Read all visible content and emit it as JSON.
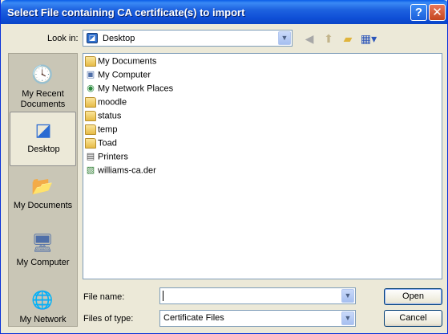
{
  "window": {
    "title": "Select File containing CA certificate(s) to import",
    "help_button": "?",
    "close_button": "✕"
  },
  "look_in": {
    "label": "Look in:",
    "value": "Desktop"
  },
  "toolbar": {
    "back_icon": "back-icon",
    "up_icon": "up-one-level-icon",
    "new_folder_icon": "new-folder-icon",
    "views_icon": "views-menu-icon"
  },
  "places": [
    {
      "label": "My Recent Documents",
      "icon": "recent-documents-icon"
    },
    {
      "label": "Desktop",
      "icon": "desktop-icon"
    },
    {
      "label": "My Documents",
      "icon": "my-documents-icon"
    },
    {
      "label": "My Computer",
      "icon": "my-computer-icon"
    },
    {
      "label": "My Network",
      "icon": "my-network-icon"
    }
  ],
  "files": [
    {
      "name": "My Documents",
      "icon": "my-documents-icon"
    },
    {
      "name": "My Computer",
      "icon": "my-computer-icon"
    },
    {
      "name": "My Network Places",
      "icon": "network-places-icon"
    },
    {
      "name": "moodle",
      "icon": "folder-icon"
    },
    {
      "name": "status",
      "icon": "folder-icon"
    },
    {
      "name": "temp",
      "icon": "folder-icon"
    },
    {
      "name": "Toad",
      "icon": "folder-icon"
    },
    {
      "name": "Printers",
      "icon": "printers-icon"
    },
    {
      "name": "williams-ca.der",
      "icon": "certificate-file-icon"
    }
  ],
  "file_name": {
    "label": "File name:",
    "value": ""
  },
  "files_of_type": {
    "label": "Files of type:",
    "value": "Certificate Files"
  },
  "buttons": {
    "open": "Open",
    "cancel": "Cancel"
  }
}
